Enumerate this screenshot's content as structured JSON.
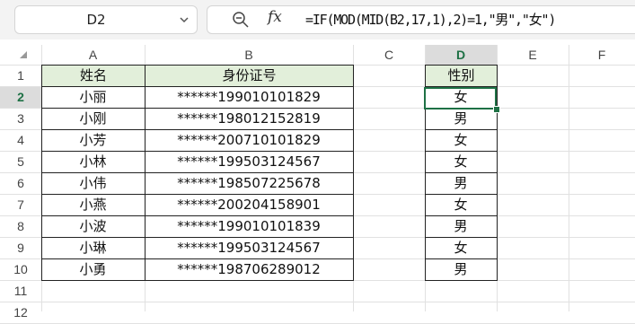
{
  "name_box": {
    "value": "D2"
  },
  "formula_bar": {
    "zoom_icon": "magnify-icon",
    "fx_label": "fx",
    "formula": "=IF(MOD(MID(B2,17,1),2)=1,\"男\",\"女\")"
  },
  "columns": [
    "A",
    "B",
    "C",
    "D",
    "E",
    "F"
  ],
  "selected_column": "D",
  "rows": [
    "1",
    "2",
    "3",
    "4",
    "5",
    "6",
    "7",
    "8",
    "9",
    "10",
    "11",
    "12"
  ],
  "selected_row": "2",
  "sheet": {
    "headers": {
      "name": "姓名",
      "id": "身份证号",
      "gender": "性别"
    },
    "records": [
      {
        "name": "小丽",
        "id": "******199010101829",
        "gender": "女"
      },
      {
        "name": "小刚",
        "id": "******198012152819",
        "gender": "男"
      },
      {
        "name": "小芳",
        "id": "******200710101829",
        "gender": "女"
      },
      {
        "name": "小林",
        "id": "******199503124567",
        "gender": "女"
      },
      {
        "name": "小伟",
        "id": "******198507225678",
        "gender": "男"
      },
      {
        "name": "小燕",
        "id": "******200204158901",
        "gender": "女"
      },
      {
        "name": "小波",
        "id": "******199010101839",
        "gender": "男"
      },
      {
        "name": "小琳",
        "id": "******199503124567",
        "gender": "女"
      },
      {
        "name": "小勇",
        "id": "******198706289012",
        "gender": "男"
      }
    ]
  },
  "colors": {
    "accent": "#1e7145",
    "header_fill": "#e2efda",
    "selected_header": "#dcdcdc"
  }
}
